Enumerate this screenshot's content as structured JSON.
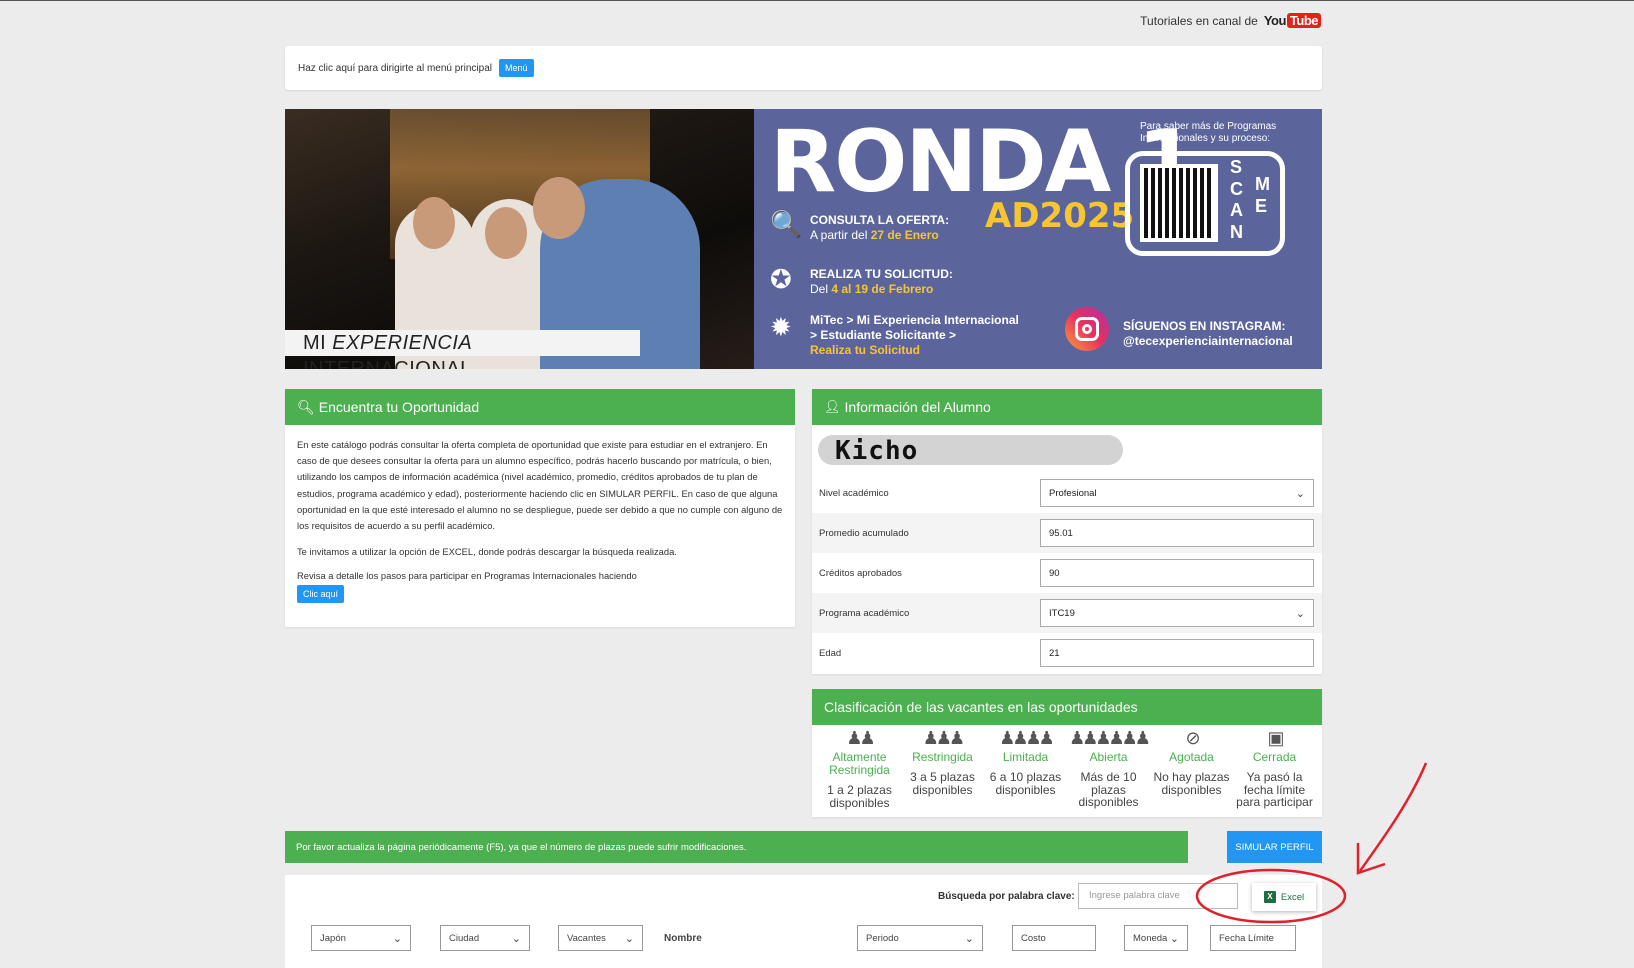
{
  "header": {
    "tutorials_text": "Tutoriales en canal de",
    "youtube_you": "You",
    "youtube_tube": "Tube"
  },
  "menu_card": {
    "text": "Haz clic aquí para dirigirte al menú principal",
    "button": "Menú"
  },
  "banner": {
    "photo_label_a": "MI ",
    "photo_label_b": "EXPERIENCIA",
    "photo_label_c": " INTERNACIONAL",
    "title": "RONDA 1",
    "subtitle": "AD2025",
    "step1_title": "CONSULTA LA OFERTA:",
    "step1_text": "A partir del ",
    "step1_date": "27 de Enero",
    "step2_title": "REALIZA TU SOLICITUD:",
    "step2_text": "Del ",
    "step2_date": "4 al 19 de Febrero",
    "step3_line1": "MiTec > Mi Experiencia Internacional",
    "step3_line2": "> Estudiante Solicitante >",
    "step3_line3": "Realiza tu Solicitud",
    "qr_text": "Para saber más de Programas Internacionales y su proceso:",
    "scan_letters": "SCAN",
    "me_letters": "ME",
    "insta_line1": "SÍGUENOS EN INSTAGRAM:",
    "insta_line2": "@tecexperienciainternacional"
  },
  "left_panel": {
    "title": "Encuentra tu Oportunidad",
    "para1": "En este catálogo podrás consultar la oferta completa de oportunidad que existe para estudiar en el extranjero. En caso de que desees consultar la oferta para un alumno específico, podrás hacerlo buscando por matrícula, o bien, utilizando los campos de información académica (nivel académico, promedio, créditos aprobados de tu plan de estudios, programa académico y edad), posteriormente haciendo clic en SIMULAR PERFIL. En caso de que alguna oportunidad en la que esté interesado el alumno no se despliegue, puede ser debido a que no cumple con alguno de los requisitos de acuerdo a su perfil académico.",
    "para2": "Te invitamos a utilizar la opción de EXCEL, donde podrás descargar la búsqueda realizada.",
    "para3": "Revisa a detalle los pasos para participar en Programas Internacionales haciendo",
    "button": "Clic aquí"
  },
  "right_panel": {
    "title": "Información del Alumno",
    "student_name": "Kicho",
    "rows": [
      {
        "label": "Nivel académico",
        "value": "Profesional"
      },
      {
        "label": "Promedio acumulado",
        "value": "95.01"
      },
      {
        "label": "Créditos aprobados",
        "value": "90"
      },
      {
        "label": "Programa académico",
        "value": "ITC19"
      },
      {
        "label": "Edad",
        "value": "21"
      }
    ]
  },
  "classification": {
    "title": "Clasificación de las vacantes en las oportunidades",
    "items": [
      {
        "label": "Altamente Restringida",
        "desc": "1 a 2 plazas disponibles",
        "icon": "people-2-icon"
      },
      {
        "label": "Restringida",
        "desc": "3 a 5 plazas disponibles",
        "icon": "people-3-icon"
      },
      {
        "label": "Limitada",
        "desc": "6 a 10 plazas disponibles",
        "icon": "people-4-icon"
      },
      {
        "label": "Abierta",
        "desc": "Más de 10 plazas disponibles",
        "icon": "people-many-icon"
      },
      {
        "label": "Agotada",
        "desc": "No hay plazas disponibles",
        "icon": "ban-icon"
      },
      {
        "label": "Cerrada",
        "desc": "Ya pasó la fecha límite para participar",
        "icon": "lock-icon"
      }
    ]
  },
  "notice": {
    "text": "Por favor actualiza la página periódicamente (F5), ya que el número de plazas puede sufrir modificaciones.",
    "simulate_button": "SIMULAR PERFIL"
  },
  "search": {
    "keyword_label": "Búsqueda por palabra clave:",
    "keyword_placeholder": "Ingrese palabra clave",
    "excel_button": "Excel",
    "filters": {
      "country": "Japón",
      "city": "Ciudad",
      "vacancies": "Vacantes",
      "name_label": "Nombre",
      "period": "Periodo",
      "cost": "Costo",
      "currency": "Moneda",
      "deadline": "Fecha Límite"
    }
  },
  "colors": {
    "green": "#4caf50",
    "blue": "#2196f3",
    "banner": "#5b659c",
    "yellow": "#f7c531",
    "annotation": "#e0202a"
  }
}
